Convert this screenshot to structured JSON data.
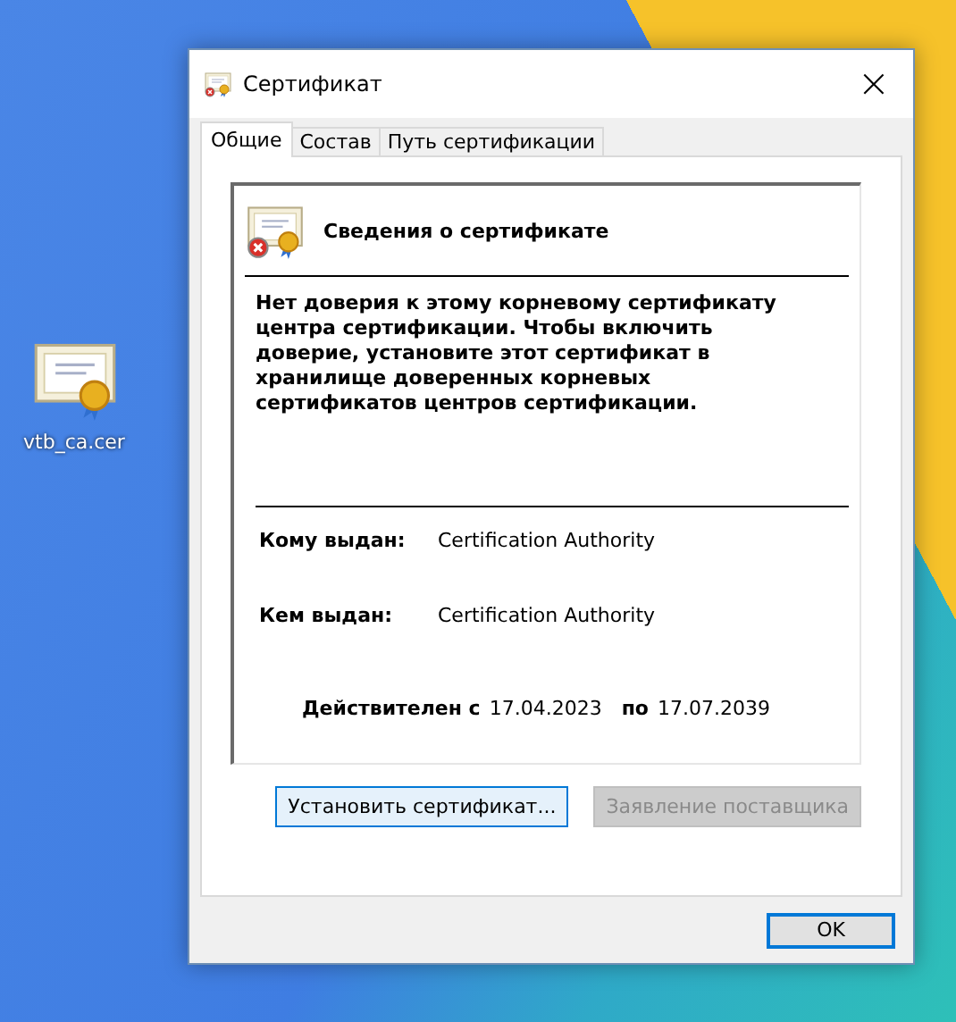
{
  "desktop_icon": {
    "label": "vtb_ca.cer"
  },
  "window": {
    "title": "Сертификат",
    "close": "×"
  },
  "tabs": [
    {
      "label": "Общие",
      "selected": true
    },
    {
      "label": "Состав",
      "selected": false
    },
    {
      "label": "Путь сертификации",
      "selected": false
    }
  ],
  "info": {
    "heading": "Сведения о сертификате",
    "message": "Нет доверия к этому корневому сертификату центра сертификации. Чтобы включить  доверие, установите этот сертификат в хранилище доверенных корневых сертификатов центров сертификации.",
    "issued_to": {
      "label": "Кому выдан:",
      "value": "Certification Authority"
    },
    "issued_by": {
      "label": "Кем выдан:",
      "value": "Certification Authority"
    },
    "validity": {
      "from_label": "Действителен с",
      "from": "17.04.2023",
      "to_label": "по",
      "to": "17.07.2039"
    }
  },
  "buttons": [
    {
      "label": "Установить сертификат...",
      "disabled": false,
      "focused": true
    },
    {
      "label": "Заявление поставщика",
      "disabled": true,
      "focused": false
    }
  ],
  "ok_button": {
    "label": "OK"
  }
}
